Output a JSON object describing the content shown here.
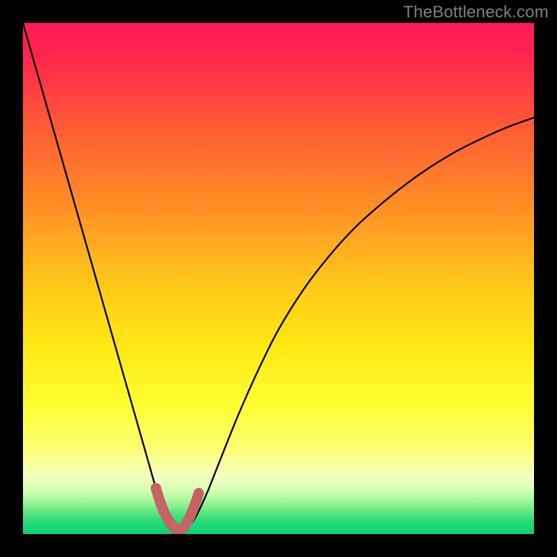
{
  "watermark": "TheBottleneck.com",
  "colors": {
    "frame": "#000000",
    "gradient_stops": [
      {
        "offset": 0.0,
        "color": "#ff1a55"
      },
      {
        "offset": 0.08,
        "color": "#ff2a4b"
      },
      {
        "offset": 0.2,
        "color": "#ff5a36"
      },
      {
        "offset": 0.35,
        "color": "#ff8c26"
      },
      {
        "offset": 0.5,
        "color": "#ffc41a"
      },
      {
        "offset": 0.63,
        "color": "#ffe714"
      },
      {
        "offset": 0.75,
        "color": "#ffff33"
      },
      {
        "offset": 0.83,
        "color": "#fbff70"
      },
      {
        "offset": 0.885,
        "color": "#f6ffbf"
      },
      {
        "offset": 0.912,
        "color": "#d8ffb8"
      },
      {
        "offset": 0.935,
        "color": "#a6f79a"
      },
      {
        "offset": 0.958,
        "color": "#5de57e"
      },
      {
        "offset": 0.978,
        "color": "#22d97a"
      },
      {
        "offset": 1.0,
        "color": "#0ed072"
      }
    ],
    "curve": "#000000",
    "marker_fill": "#c46464",
    "marker_stroke": "#c46464"
  },
  "chart_data": {
    "type": "line",
    "title": "",
    "xlabel": "",
    "ylabel": "",
    "xlim": [
      0,
      100
    ],
    "ylim": [
      0,
      100
    ],
    "grid": false,
    "legend": false,
    "series": [
      {
        "name": "bottleneck-curve",
        "x": [
          0,
          2,
          4,
          6,
          8,
          10,
          12,
          14,
          16,
          18,
          20,
          22,
          24,
          26,
          27,
          28,
          29,
          30,
          31,
          32,
          33,
          34,
          36,
          38,
          42,
          46,
          50,
          55,
          60,
          65,
          70,
          75,
          80,
          85,
          90,
          95,
          100
        ],
        "y": [
          100,
          93,
          86,
          79,
          72,
          65,
          58,
          51,
          44,
          37,
          30,
          23,
          16,
          9,
          6,
          3.7,
          2.1,
          1.0,
          0.5,
          1.0,
          2.1,
          3.7,
          8,
          13,
          23,
          32,
          40,
          48,
          54.5,
          60,
          64.5,
          68.5,
          72,
          75,
          77.5,
          79.7,
          81.5
        ]
      }
    ],
    "markers": {
      "name": "highlight-band",
      "x": [
        26,
        26.6,
        27.2,
        27.8,
        28.4,
        29,
        29.6,
        30.2,
        30.8,
        31.4,
        32,
        32.6,
        33.2,
        33.8,
        34.4
      ],
      "y": [
        9,
        7,
        5.3,
        3.9,
        2.8,
        1.9,
        1.2,
        0.8,
        0.9,
        1.3,
        2.1,
        3.2,
        4.6,
        6.2,
        8
      ]
    }
  }
}
